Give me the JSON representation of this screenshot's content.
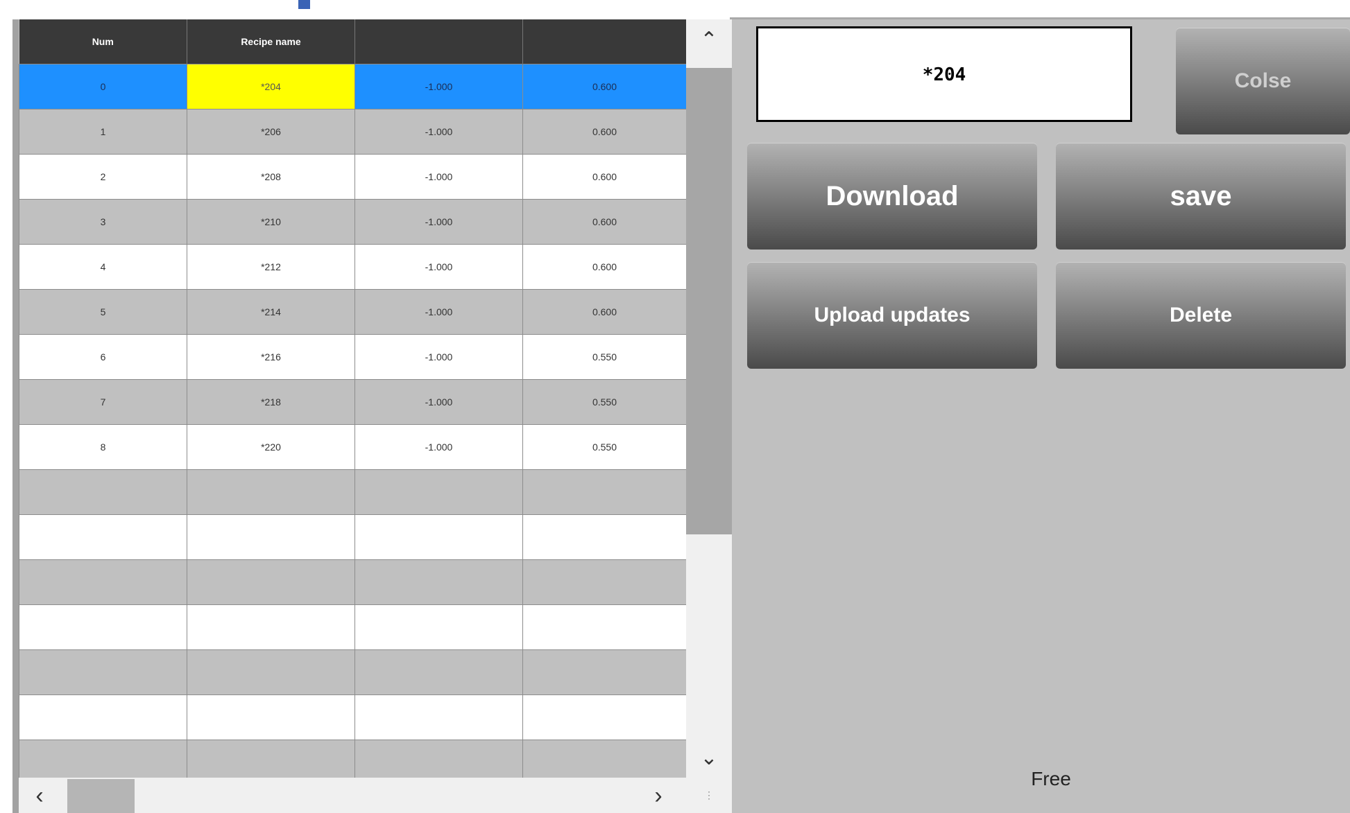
{
  "table": {
    "columns": [
      "Num",
      "Recipe name",
      "",
      ""
    ],
    "rows": [
      [
        "0",
        "*204",
        "-1.000",
        "0.600"
      ],
      [
        "1",
        "*206",
        "-1.000",
        "0.600"
      ],
      [
        "2",
        "*208",
        "-1.000",
        "0.600"
      ],
      [
        "3",
        "*210",
        "-1.000",
        "0.600"
      ],
      [
        "4",
        "*212",
        "-1.000",
        "0.600"
      ],
      [
        "5",
        "*214",
        "-1.000",
        "0.600"
      ],
      [
        "6",
        "*216",
        "-1.000",
        "0.550"
      ],
      [
        "7",
        "*218",
        "-1.000",
        "0.550"
      ],
      [
        "8",
        "*220",
        "-1.000",
        "0.550"
      ],
      [
        "",
        "",
        "",
        ""
      ],
      [
        "",
        "",
        "",
        ""
      ],
      [
        "",
        "",
        "",
        ""
      ],
      [
        "",
        "",
        "",
        ""
      ],
      [
        "",
        "",
        "",
        ""
      ],
      [
        "",
        "",
        "",
        ""
      ],
      [
        "",
        "",
        "",
        ""
      ]
    ],
    "selected_row": 0,
    "highlighted_column": 1,
    "colors": {
      "selected_row": "#1e90ff",
      "highlighted_cell": "#ffff00",
      "header": "#393939"
    }
  },
  "scrollbar": {
    "up_icon": "chevron-up-icon",
    "down_icon": "chevron-down-icon",
    "left_icon": "chevron-left-icon",
    "right_icon": "chevron-right-icon"
  },
  "panel": {
    "recipe_name": "*204",
    "buttons": {
      "close": "Colse",
      "download": "Download",
      "save": "save",
      "upload": "Upload updates",
      "delete": "Delete"
    },
    "status": "Free"
  }
}
